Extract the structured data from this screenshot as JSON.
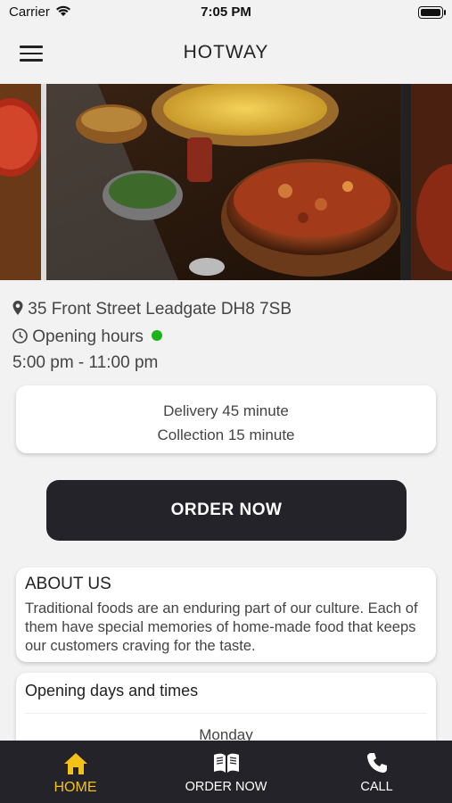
{
  "status_bar": {
    "carrier": "Carrier",
    "time": "7:05 PM"
  },
  "header": {
    "title": "HOTWAY"
  },
  "info": {
    "address": "35 Front Street  Leadgate  DH8 7SB",
    "opening_label": "Opening hours",
    "hours": "5:00 pm - 11:00 pm",
    "open_status_color": "#1db31d"
  },
  "delivery": {
    "delivery_text": "Delivery 45 minute",
    "collection_text": "Collection 15 minute"
  },
  "order_button": {
    "label": "ORDER NOW"
  },
  "about": {
    "heading": "ABOUT US",
    "body": "Traditional foods are an enduring part of our culture. Each of them have special memories of home-made food that keeps our customers craving for the taste."
  },
  "opening_days": {
    "heading": "Opening days and times",
    "first_day": "Monday"
  },
  "tabbar": {
    "tabs": [
      {
        "label": "HOME",
        "icon": "home-icon",
        "active": true
      },
      {
        "label": "ORDER NOW",
        "icon": "menu-book-icon",
        "active": false
      },
      {
        "label": "CALL",
        "icon": "phone-icon",
        "active": false
      }
    ],
    "active_color": "#f2c218"
  }
}
